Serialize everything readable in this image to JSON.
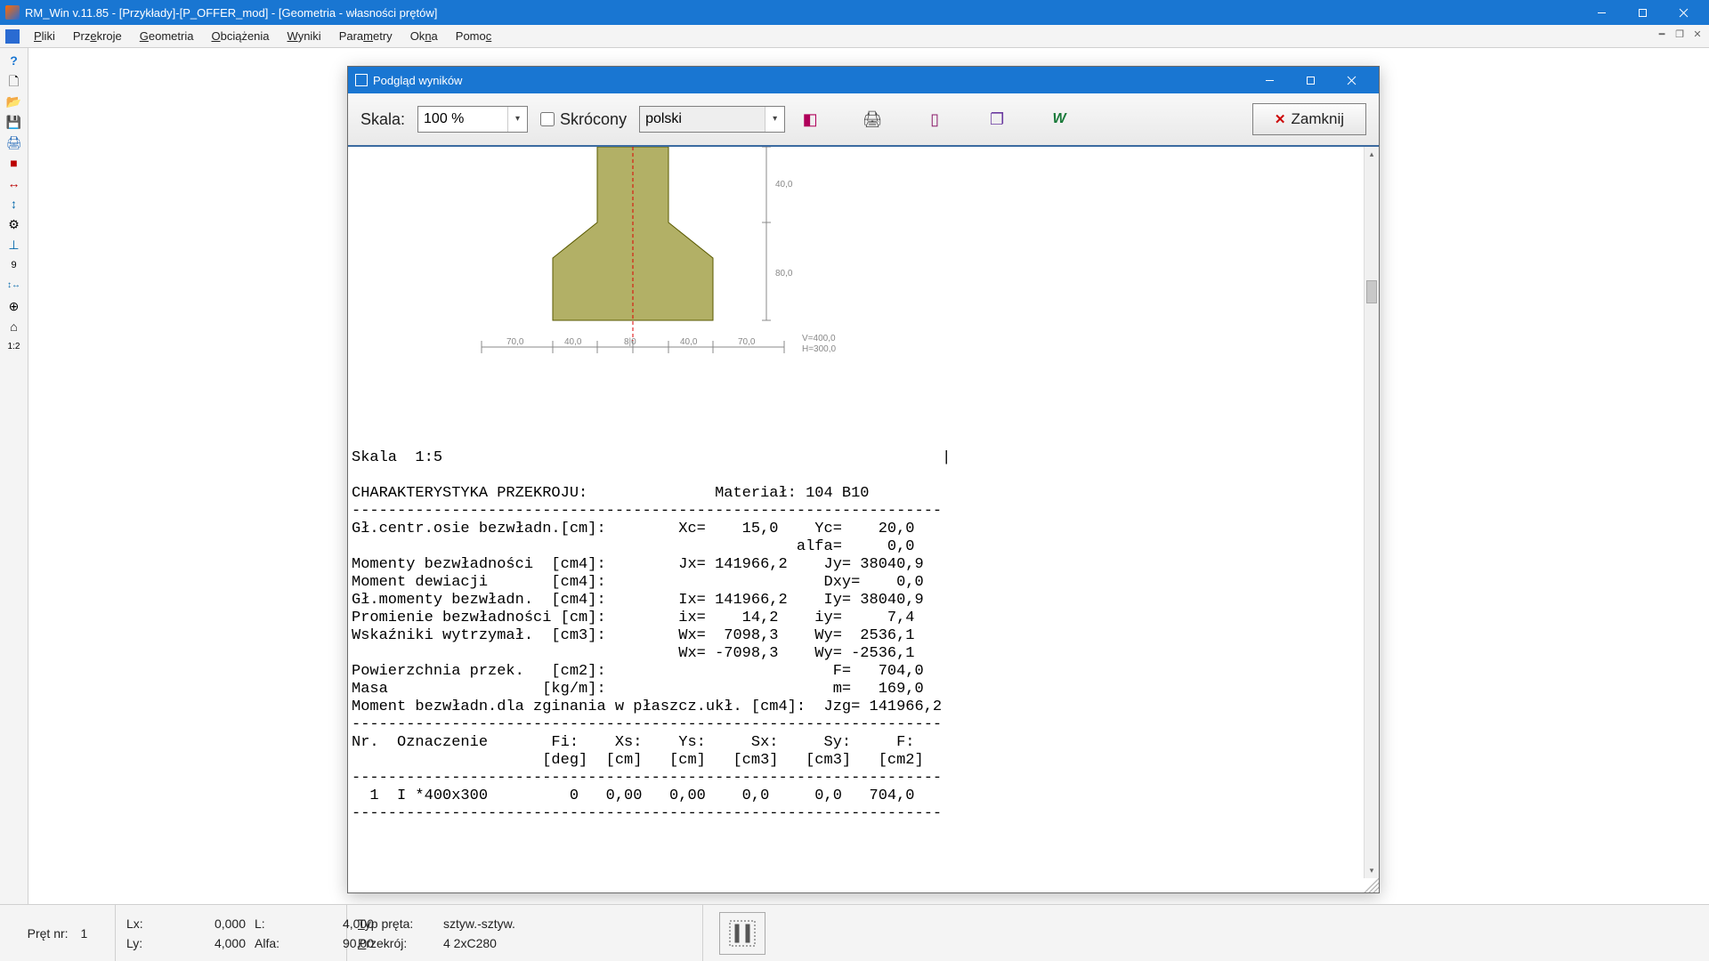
{
  "window": {
    "title": "RM_Win v.11.85 - [Przykłady]-[P_OFFER_mod] - [Geometria - własności prętów]"
  },
  "menu": {
    "pliki": "Pliki",
    "przekroje": "Przekroje",
    "geometria": "Geometria",
    "obciazenia": "Obciążenia",
    "wyniki": "Wyniki",
    "parametry": "Parametry",
    "okna": "Okna",
    "pomoc": "Pomoc"
  },
  "sidebar_icons": [
    "?",
    "🗋",
    "📂",
    "💾",
    "🖨",
    "■",
    "↔",
    "↕",
    "⚙",
    "⊥",
    "9",
    "↕↔",
    "⊕",
    "⌂",
    "1:2"
  ],
  "preview": {
    "title": "Podgląd wyników",
    "scale_label": "Skala:",
    "scale_value": "100 %",
    "short_label": "Skrócony",
    "short_checked": false,
    "language": "polski",
    "close_label": "Zamknij"
  },
  "drawing": {
    "dims_bottom": [
      "70,0",
      "40,0",
      "8|0",
      "40,0",
      "70,0"
    ],
    "dims_right": [
      "40,0",
      "80,0"
    ],
    "overall": [
      "V=400,0",
      "H=300,0"
    ]
  },
  "report_text": "Skala  1:5                                                       |\n\nCHARAKTERYSTYKA PRZEKROJU:              Materiał: 104 B10\n-----------------------------------------------------------------\nGł.centr.osie bezwładn.[cm]:        Xc=    15,0    Yc=    20,0\n                                                 alfa=     0,0\nMomenty bezwładności  [cm4]:        Jx= 141966,2    Jy= 38040,9\nMoment dewiacji       [cm4]:                        Dxy=    0,0\nGł.momenty bezwładn.  [cm4]:        Ix= 141966,2    Iy= 38040,9\nPromienie bezwładności [cm]:        ix=    14,2    iy=     7,4\nWskaźniki wytrzymał.  [cm3]:        Wx=  7098,3    Wy=  2536,1\n                                    Wx= -7098,3    Wy= -2536,1\nPowierzchnia przek.   [cm2]:                         F=   704,0\nMasa                 [kg/m]:                         m=   169,0\nMoment bezwładn.dla zginania w płaszcz.ukł. [cm4]:  Jzg= 141966,2\n-----------------------------------------------------------------\nNr.  Oznaczenie       Fi:    Xs:    Ys:     Sx:     Sy:     F:\n                     [deg]  [cm]   [cm]   [cm3]   [cm3]   [cm2]\n-----------------------------------------------------------------\n  1  I *400x300         0   0,00   0,00    0,0     0,0   704,0\n-----------------------------------------------------------------",
  "status": {
    "pret_label": "Pręt nr:",
    "pret_value": "1",
    "lx_label": "Lx:",
    "lx_value": "0,000",
    "ly_label": "Ly:",
    "ly_value": "4,000",
    "l_label": "L:",
    "l_value": "4,000",
    "alfa_label": "Alfa:",
    "alfa_value": "90,00",
    "typ_label": "Typ pręta:",
    "typ_value": "sztyw.-sztyw.",
    "przekroj_label": "Przekrój:",
    "przekroj_value": "4   2xC280"
  }
}
